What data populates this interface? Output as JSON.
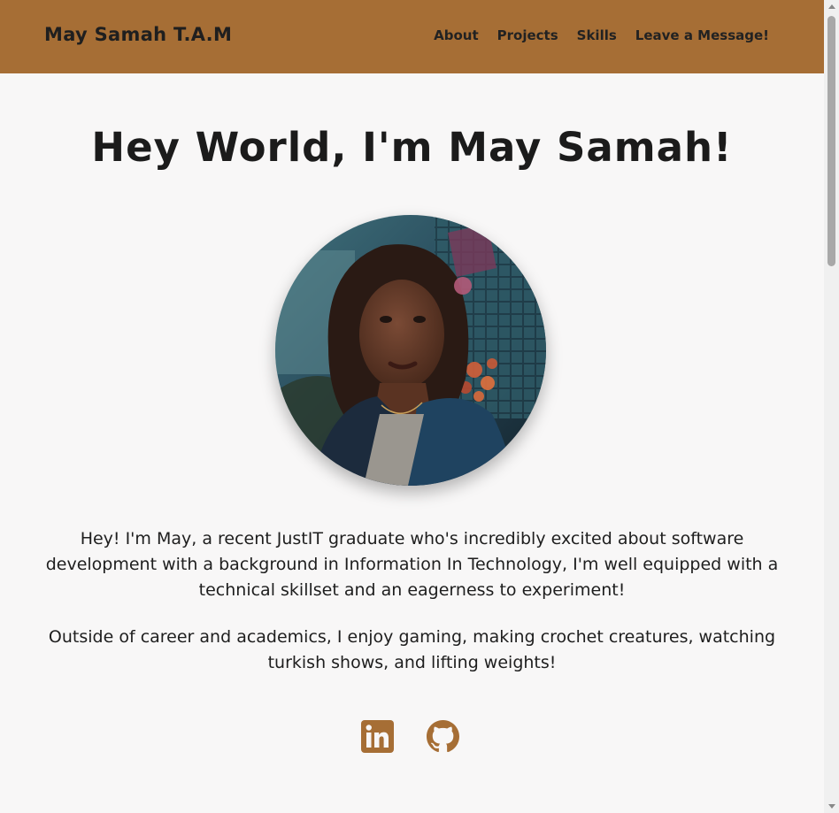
{
  "nav": {
    "brand": "May Samah T.A.M",
    "links": [
      {
        "label": "About"
      },
      {
        "label": "Projects"
      },
      {
        "label": "Skills"
      },
      {
        "label": "Leave a Message!"
      }
    ]
  },
  "hero": {
    "title": "Hey World, I'm May Samah!",
    "bio": [
      "Hey! I'm May, a recent JustIT graduate who's incredibly excited about software development with a background in Information In Technology, I'm well equipped with a technical skillset and an eagerness to experiment!",
      "Outside of career and academics, I enjoy gaming, making crochet creatures, watching turkish shows, and lifting weights!"
    ]
  },
  "socials": [
    {
      "icon": "linkedin-icon"
    },
    {
      "icon": "github-icon"
    }
  ],
  "colors": {
    "accent": "#a66e35",
    "background": "#f8f7f7",
    "text": "#1d1d1d"
  }
}
